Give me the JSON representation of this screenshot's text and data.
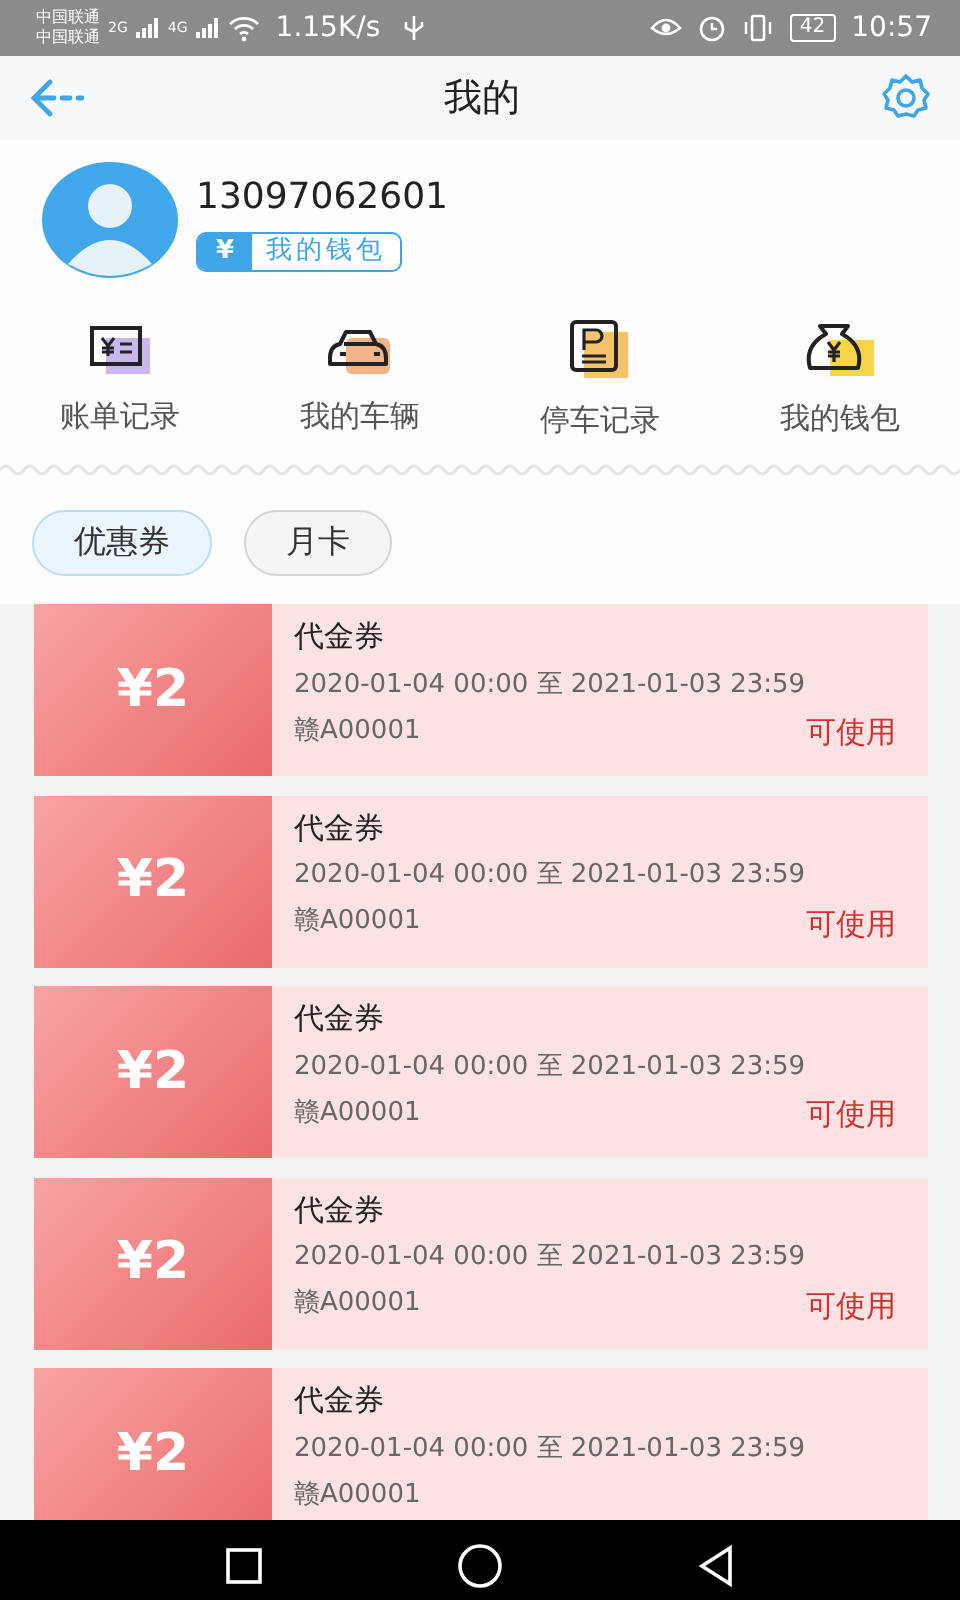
{
  "status_bar": {
    "carriers": [
      "中国联通",
      "中国联通"
    ],
    "network_types": [
      "2G",
      "4G"
    ],
    "speed": "1.15K/s",
    "battery": "42",
    "time": "10:57"
  },
  "header": {
    "title": "我的"
  },
  "profile": {
    "phone": "13097062601",
    "wallet_symbol": "¥",
    "wallet_label": "我的钱包"
  },
  "shortcuts": [
    {
      "kind": "bill",
      "label": "账单记录"
    },
    {
      "kind": "car",
      "label": "我的车辆"
    },
    {
      "kind": "parking",
      "label": "停车记录"
    },
    {
      "kind": "wallet",
      "label": "我的钱包"
    }
  ],
  "tabs": [
    {
      "label": "优惠券",
      "selected": true
    },
    {
      "label": "月卡",
      "selected": false
    }
  ],
  "coupons": [
    {
      "amount": "¥2",
      "title": "代金券",
      "period": "2020-01-04 00:00 至 2021-01-03 23:59",
      "plate": "赣A00001",
      "status": "可使用"
    },
    {
      "amount": "¥2",
      "title": "代金券",
      "period": "2020-01-04 00:00 至 2021-01-03 23:59",
      "plate": "赣A00001",
      "status": "可使用"
    },
    {
      "amount": "¥2",
      "title": "代金券",
      "period": "2020-01-04 00:00 至 2021-01-03 23:59",
      "plate": "赣A00001",
      "status": "可使用"
    },
    {
      "amount": "¥2",
      "title": "代金券",
      "period": "2020-01-04 00:00 至 2021-01-03 23:59",
      "plate": "赣A00001",
      "status": "可使用"
    },
    {
      "amount": "¥2",
      "title": "代金券",
      "period": "2020-01-04 00:00 至 2021-01-03 23:59",
      "plate": "赣A00001"
    }
  ]
}
